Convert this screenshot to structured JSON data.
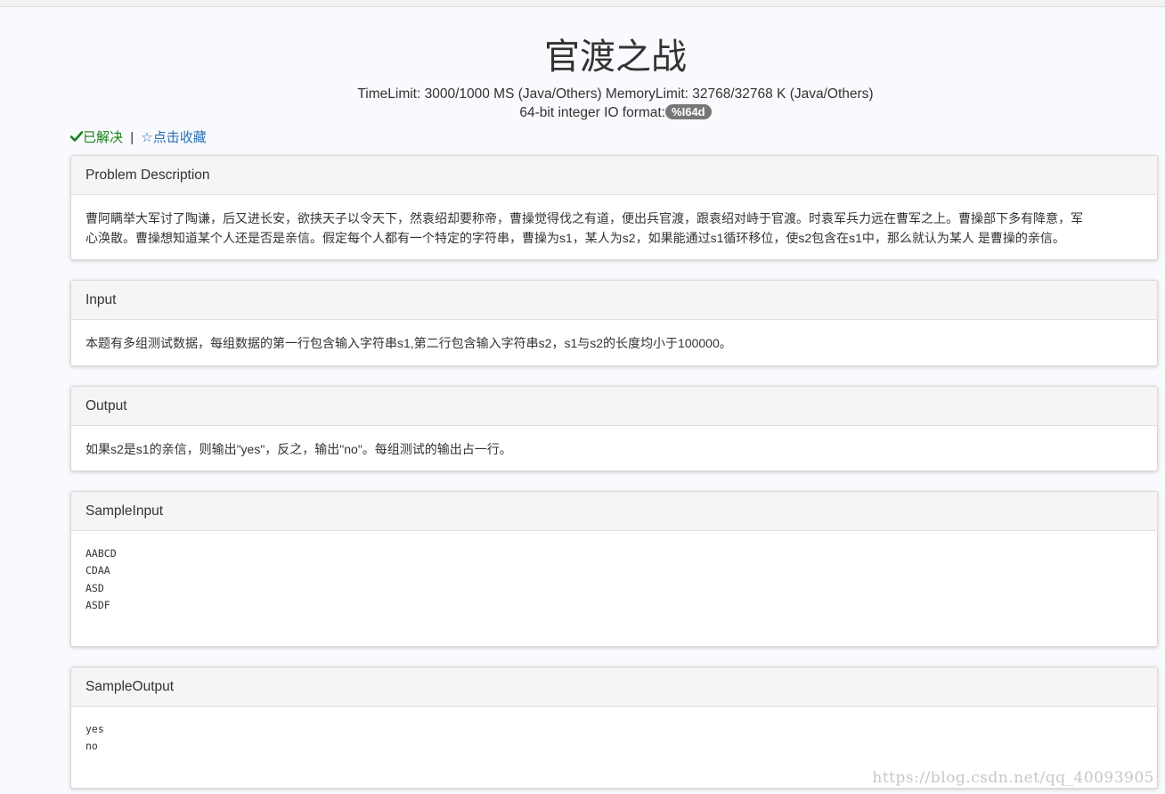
{
  "problem": {
    "title": "官渡之战",
    "limits": "TimeLimit: 3000/1000 MS (Java/Others)  MemoryLimit: 32768/32768 K (Java/Others)",
    "format_label": "64-bit integer IO format:",
    "format_value": "%I64d"
  },
  "status": {
    "solved_label": "已解决",
    "separator": "|",
    "favorite_label": "☆点击收藏",
    "solved_color": "#1a7f1a",
    "link_color": "#2a6fb3"
  },
  "sections": {
    "description": {
      "heading": "Problem Description",
      "line1": "曹阿瞒举大军讨了陶谦，后又进长安，欲挟天子以令天下，然袁绍却要称帝，曹操觉得伐之有道，便出兵官渡，跟袁绍对峙于官渡。时袁军兵力远在曹军之上。曹操部下多有降意，军",
      "line2": "心涣散。曹操想知道某个人还是否是亲信。假定每个人都有一个特定的字符串，曹操为s1，某人为s2，如果能通过s1循环移位，使s2包含在s1中，那么就认为某人 是曹操的亲信。"
    },
    "input": {
      "heading": "Input",
      "text": "本题有多组测试数据，每组数据的第一行包含输入字符串s1,第二行包含输入字符串s2，s1与s2的长度均小于100000。"
    },
    "output": {
      "heading": "Output",
      "text": "如果s2是s1的亲信，则输出\"yes\"，反之，输出\"no\"。每组测试的输出占一行。"
    },
    "sample_input": {
      "heading": "SampleInput",
      "lines": [
        "AABCD",
        "CDAA",
        "ASD",
        "ASDF"
      ]
    },
    "sample_output": {
      "heading": "SampleOutput",
      "lines": [
        "yes",
        "no"
      ]
    }
  },
  "watermark": "https://blog.csdn.net/qq_40093905"
}
